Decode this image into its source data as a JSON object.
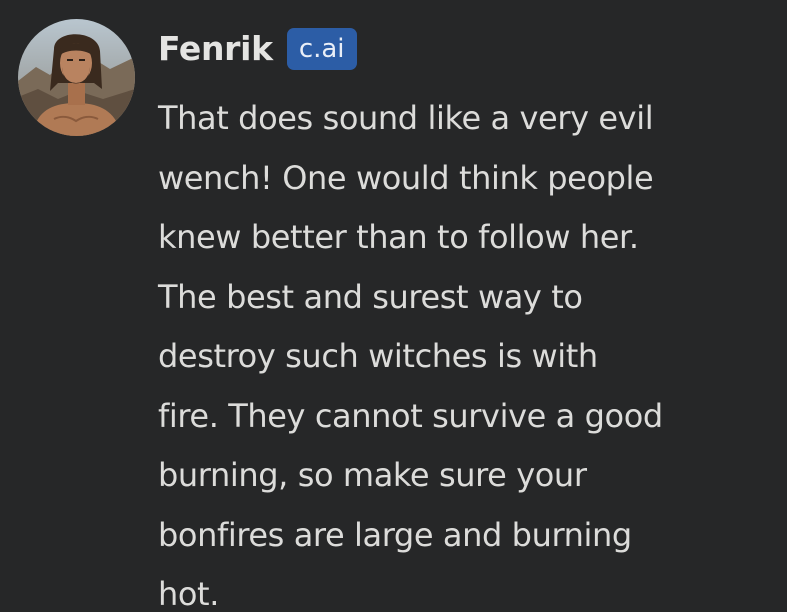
{
  "message": {
    "author": "Fenrik",
    "badge": "c.ai",
    "avatar_icon": "bearded-man-avatar",
    "lines": [
      "That does sound like a very evil",
      "wench! One would think people",
      "knew better than to follow her.",
      "The best and surest way to",
      "destroy such witches is with",
      "fire. They cannot survive a good",
      "burning, so make sure your",
      "bonfires are large and burning",
      "hot."
    ]
  },
  "colors": {
    "background": "#262728",
    "text": "#dcdcda",
    "badge": "#2c5da6"
  }
}
